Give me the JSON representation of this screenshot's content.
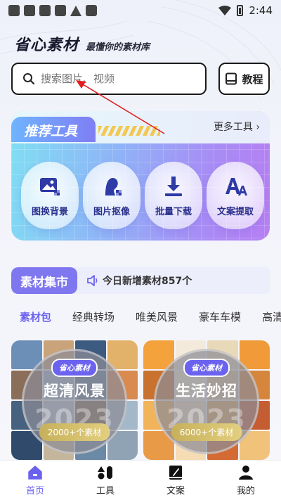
{
  "status_bar": {
    "time": "2:44"
  },
  "brand": {
    "title": "省心素材",
    "slogan": "最懂你的素材库"
  },
  "search": {
    "placeholder": "搜索图片、视频"
  },
  "tutorial_button": {
    "label": "教程",
    "icon": "book-icon"
  },
  "tools": {
    "title": "推荐工具",
    "more_label": "更多工具 ›",
    "items": [
      {
        "label": "图换背景",
        "icon": "image-replace-icon"
      },
      {
        "label": "图片抠像",
        "icon": "portrait-cutout-icon"
      },
      {
        "label": "批量下载",
        "icon": "download-icon"
      },
      {
        "label": "文案提取",
        "icon": "text-extract-icon"
      }
    ]
  },
  "market": {
    "title": "素材集市",
    "news": "今日新增素材857个"
  },
  "categories": [
    "素材包",
    "经典转场",
    "唯美风景",
    "豪车车模",
    "高清壁"
  ],
  "packs": [
    {
      "brand": "省心素材",
      "title": "超清风景",
      "year": "2023",
      "count": "2000+个素材"
    },
    {
      "brand": "省心素材",
      "title": "生活妙招",
      "year": "2023",
      "count": "6000+个素材"
    }
  ],
  "bottom_nav": [
    {
      "label": "首页",
      "icon": "home-icon",
      "active": true
    },
    {
      "label": "工具",
      "icon": "tools-icon",
      "active": false
    },
    {
      "label": "文案",
      "icon": "notebook-icon",
      "active": false
    },
    {
      "label": "我的",
      "icon": "user-icon",
      "active": false
    }
  ],
  "colors": {
    "accent": "#6a62ef",
    "annotation": "#e02020"
  }
}
